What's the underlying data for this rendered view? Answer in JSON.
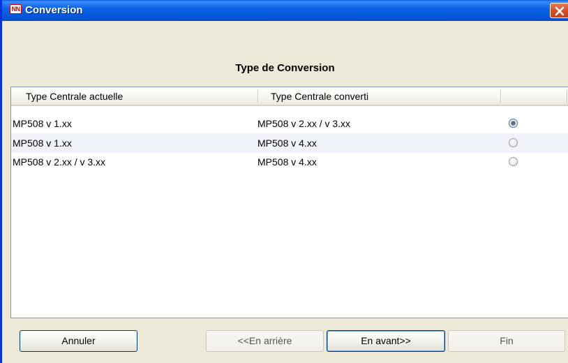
{
  "window": {
    "title": "Conversion",
    "icon": "nn-logo-icon"
  },
  "header": {
    "title": "Type de Conversion"
  },
  "list": {
    "columns": [
      "Type Centrale actuelle",
      "Type Centrale converti",
      ""
    ],
    "rows": [
      {
        "current": "MP508 v 1.xx",
        "converted": "MP508 v 2.xx / v 3.xx",
        "selected": true
      },
      {
        "current": "MP508 v 1.xx",
        "converted": "MP508 v 4.xx",
        "selected": false
      },
      {
        "current": "MP508 v 2.xx / v 3.xx",
        "converted": "MP508 v 4.xx",
        "selected": false
      }
    ]
  },
  "buttons": {
    "cancel": "Annuler",
    "back": "<<En arrière",
    "next": "En avant>>",
    "finish": "Fin"
  },
  "colors": {
    "titlebar": "#0454d6",
    "close": "#d34a22",
    "panel": "#ece9d8",
    "alt_row": "#f0f4fa"
  }
}
